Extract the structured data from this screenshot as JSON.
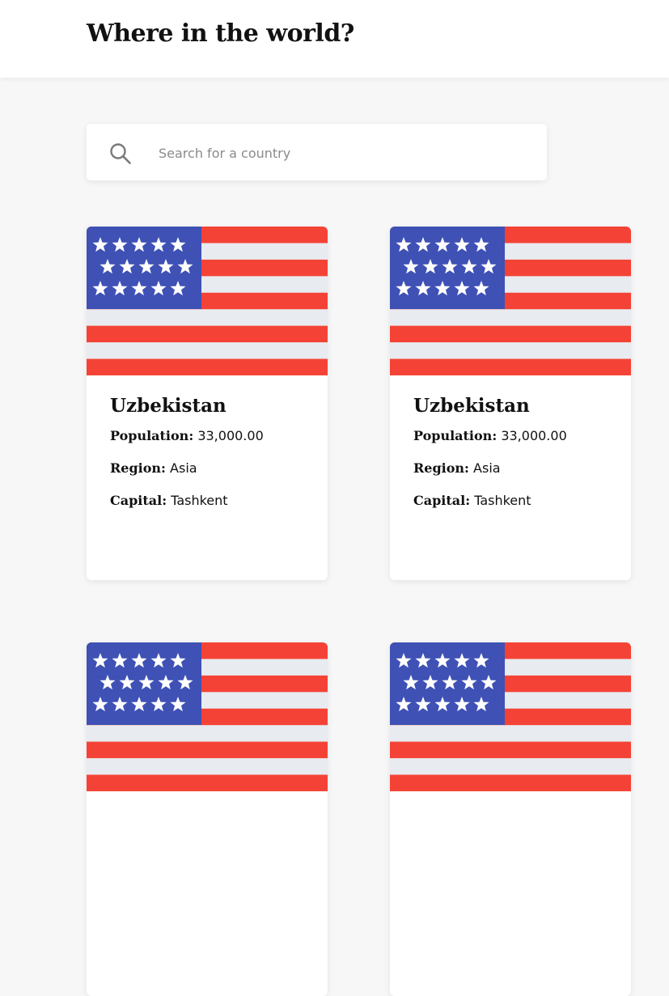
{
  "header": {
    "title": "Where in the world?"
  },
  "search": {
    "placeholder": "Search for a country",
    "icon": "search-icon"
  },
  "colors": {
    "flag_red": "#f44336",
    "flag_white": "#e8ebef",
    "flag_blue": "#3f51b5"
  },
  "labels": {
    "population": "Population:",
    "region": "Region:",
    "capital": "Capital:"
  },
  "countries": [
    {
      "name": "Uzbekistan",
      "population": "33,000.00",
      "region": "Asia",
      "capital": "Tashkent",
      "flag": "us-flag-icon"
    },
    {
      "name": "Uzbekistan",
      "population": "33,000.00",
      "region": "Asia",
      "capital": "Tashkent",
      "flag": "us-flag-icon"
    },
    {
      "flag": "us-flag-icon"
    },
    {
      "flag": "us-flag-icon"
    }
  ]
}
